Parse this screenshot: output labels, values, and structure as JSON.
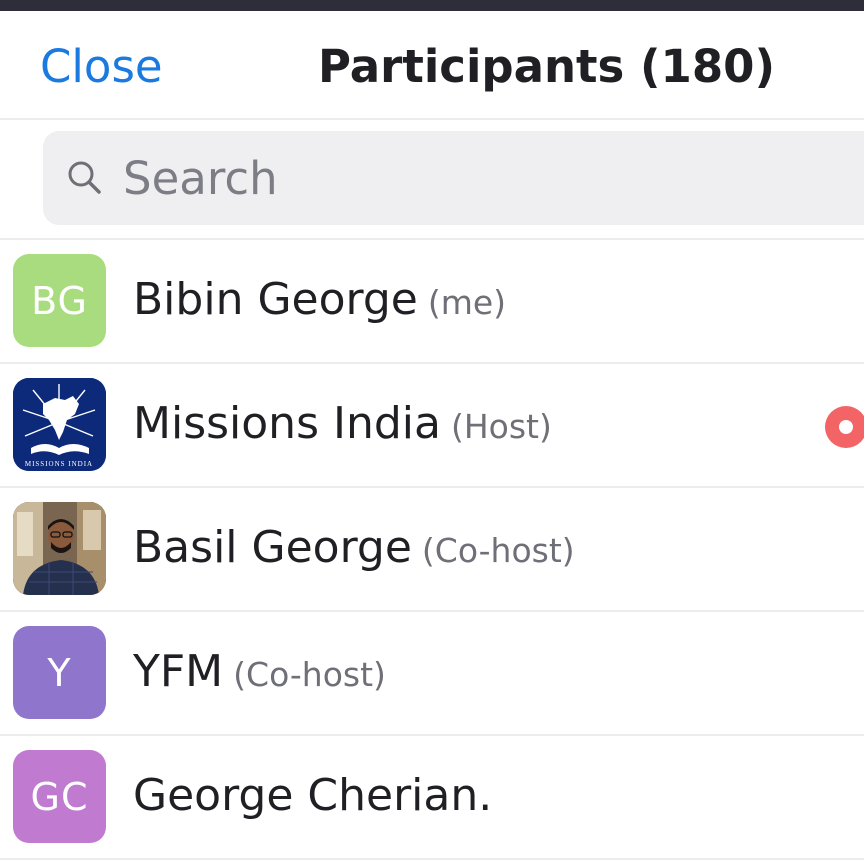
{
  "header": {
    "close_label": "Close",
    "title": "Participants (180)"
  },
  "search": {
    "placeholder": "Search",
    "icon": "search-icon"
  },
  "participants": [
    {
      "name": "Bibin George",
      "role": "(me)",
      "avatar_initials": "BG",
      "avatar_color": "#a9dc7f",
      "avatar_type": "initials"
    },
    {
      "name": "Missions India",
      "role": "(Host)",
      "avatar_initials": "",
      "avatar_color": "#0d2a7a",
      "avatar_type": "logo",
      "avatar_logo_text": "MISSIONS INDIA",
      "status_icon": "recording-icon",
      "status_color": "#f26465"
    },
    {
      "name": "Basil George",
      "role": "(Co-host)",
      "avatar_initials": "",
      "avatar_color": "#5a4a3a",
      "avatar_type": "photo"
    },
    {
      "name": "YFM",
      "role": "(Co-host)",
      "avatar_initials": "Y",
      "avatar_color": "#8f76cc",
      "avatar_type": "initials"
    },
    {
      "name": "George Cherian.",
      "role": "",
      "avatar_initials": "GC",
      "avatar_color": "#c07ad0",
      "avatar_type": "initials"
    }
  ],
  "colors": {
    "accent": "#1a7ae0",
    "top_strip": "#2e2e3a"
  }
}
